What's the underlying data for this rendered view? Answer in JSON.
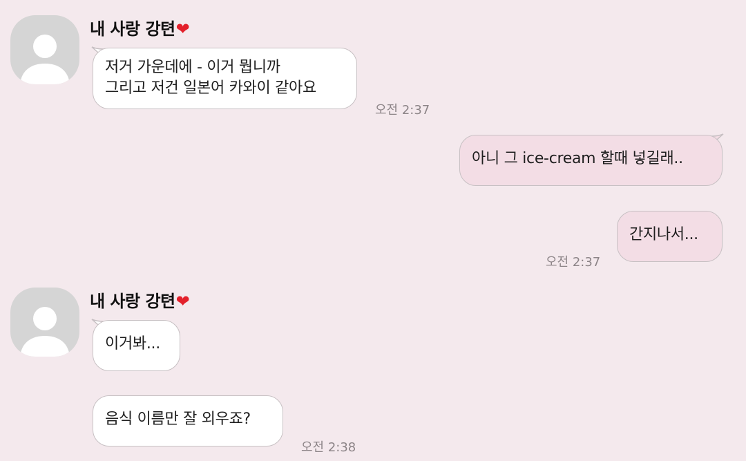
{
  "chat": {
    "groups": [
      {
        "sender": "내 사랑 강텬",
        "heart": "❤",
        "messages": [
          {
            "lines": [
              "저거 가운데에 - 이거 뭡니까",
              "그리고 저건 일본어 카와이 같아요"
            ]
          }
        ],
        "time": "오전 2:37"
      },
      {
        "sender": "me",
        "messages": [
          {
            "text": "아니 그 ice-cream 할때 넣길래.."
          },
          {
            "text": "간지나서..."
          }
        ],
        "time": "오전 2:37"
      },
      {
        "sender": "내 사랑 강텬",
        "heart": "❤",
        "messages": [
          {
            "text": "이거봐..."
          },
          {
            "text": "음식 이름만 잘 외우죠?"
          }
        ],
        "time": "오전 2:38"
      }
    ]
  },
  "colors": {
    "background": "#f4e9ed",
    "incoming_bubble": "#ffffff",
    "outgoing_bubble": "#f3dde5",
    "heart": "#e3202b"
  }
}
